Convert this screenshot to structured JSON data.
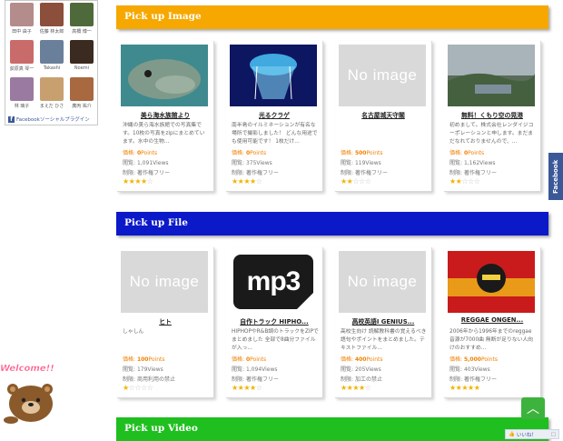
{
  "facebook_widget": {
    "top_row": "... ... ... ...",
    "friends": [
      {
        "name": "田中 由子",
        "color": "#b58c8c"
      },
      {
        "name": "佐藤 林太郎",
        "color": "#8c4f3c"
      },
      {
        "name": "高橋 博一",
        "color": "#4f6a3a"
      },
      {
        "name": "荻原真 琴一",
        "color": "#c96b6b"
      },
      {
        "name": "Takashi",
        "color": "#6a7f9a"
      },
      {
        "name": "Noemi",
        "color": "#3a2a20"
      },
      {
        "name": "林 璃子",
        "color": "#9a7aa0"
      },
      {
        "name": "まえだ ひさ",
        "color": "#c8a070"
      },
      {
        "name": "廣丙 祐介",
        "color": "#a86840"
      }
    ],
    "footer": "Facebookソーシャルプラグイン"
  },
  "sections": {
    "image": {
      "title": "Pick up Image"
    },
    "file": {
      "title": "Pick up File"
    },
    "video": {
      "title": "Pick up Video"
    }
  },
  "labels": {
    "price": "価格:",
    "views": "閲覧:",
    "restriction": "制限:",
    "points_unit": "Points",
    "views_unit": "Views"
  },
  "image_cards": [
    {
      "title": "美ら海水族館より",
      "thumb": "fish",
      "desc": "沖縄の美ら海水族館での写真集です。10枚の写真をzipにまとめています。水中の生物...",
      "price": "0",
      "views": "1,091",
      "restriction": "著作権フリー",
      "rating": 4
    },
    {
      "title": "光るクラゲ",
      "thumb": "jelly",
      "desc": "南半島のイルミネーションが有名な場所で撮影しました！ どんな用途でも使用可能です！ 1枚だけ...",
      "price": "0",
      "views": "375",
      "restriction": "著作権フリー",
      "rating": 3.5
    },
    {
      "title": "名古屋城天守閣",
      "thumb": "noimage",
      "no_image_text": "No image",
      "desc": "",
      "price": "500",
      "views": "119",
      "restriction": "著作権フリー",
      "rating": 2
    },
    {
      "title": "無料！くもり空の晃港",
      "thumb": "harbor",
      "desc": "初めまして。株式会社レンダイジコーポレーションと申します。まだまだなれておりませんので、...",
      "price": "0",
      "views": "1,162",
      "restriction": "著作権フリー",
      "rating": 1.5
    }
  ],
  "file_cards": [
    {
      "title": "ヒト",
      "thumb": "noimage",
      "no_image_text": "No image",
      "desc": "しゃしん",
      "price": "100",
      "views": "179",
      "restriction": "商用利用の禁止",
      "rating": 1
    },
    {
      "title": "自作トラック HIPHO...",
      "thumb": "mp3",
      "mp3_text": "mp3",
      "desc": "HIPHOPやR&B調のトラックをZIPでまとめました 全部で8曲分ファイルが入っ...",
      "price": "0",
      "views": "1,094",
      "restriction": "著作権フリー",
      "rating": 3.5
    },
    {
      "title": "高校英語Ⅰ GENIUS...",
      "thumb": "noimage",
      "no_image_text": "No image",
      "desc": "高校生向け 読解教科書の覚えるべき語句やポイントをまとめました。テキストファイル...",
      "price": "400",
      "views": "205",
      "restriction": "加工の禁止",
      "rating": 4
    },
    {
      "title": "REGGAE ONGEN...",
      "thumb": "reggae",
      "desc": "2006年から1996年までのreggae音源が7000曲 無断が足りない人向けのおすすめ...",
      "price": "5,000",
      "views": "403",
      "restriction": "著作権フリー",
      "rating": 5
    }
  ],
  "side_tab": {
    "label": "Facebook"
  },
  "welcome": {
    "text": "Welcome!!"
  },
  "like_bar": {
    "label": "いいね！"
  },
  "colors": {
    "orange": "#f6a800",
    "blue": "#0b19c9",
    "green": "#1fbf1f",
    "price": "#f08000",
    "star": "#f0b400"
  }
}
